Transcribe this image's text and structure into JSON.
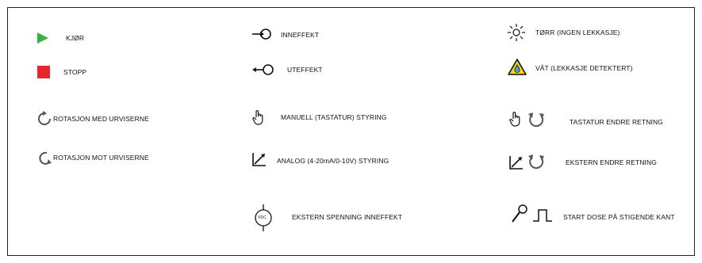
{
  "legend": {
    "col1": {
      "run": "KJØR",
      "stop": "STOPP",
      "rotation_cw": "ROTASJON MED URVISERNE",
      "rotation_ccw": "ROTASJON MOT URVISERNE"
    },
    "col2": {
      "input": "INNEFFEKT",
      "output": "UTEFFEKT",
      "manual": "MANUELL (TASTATUR) STYRING",
      "analog": "ANALOG (4-20mA/0-10V) STYRING",
      "ext_voltage": "EKSTERN SPENNING INNEFFEKT",
      "vdc_label": "VDC"
    },
    "col3": {
      "dry": "TØRR (INGEN LEKKASJE)",
      "wet": "VÅT (LEKKASJE DETEKTERT)",
      "keypad_reverse": "TASTATUR ENDRE RETNING",
      "external_reverse": "EKSTERN ENDRE RETNING",
      "start_dose": "START DOSE PÅ STIGENDE KANT"
    }
  },
  "colors": {
    "run_green": "#3cb043",
    "stop_red": "#e8252b",
    "warning_yellow": "#f2d21b",
    "rotation_blue": "#4aa3df"
  }
}
